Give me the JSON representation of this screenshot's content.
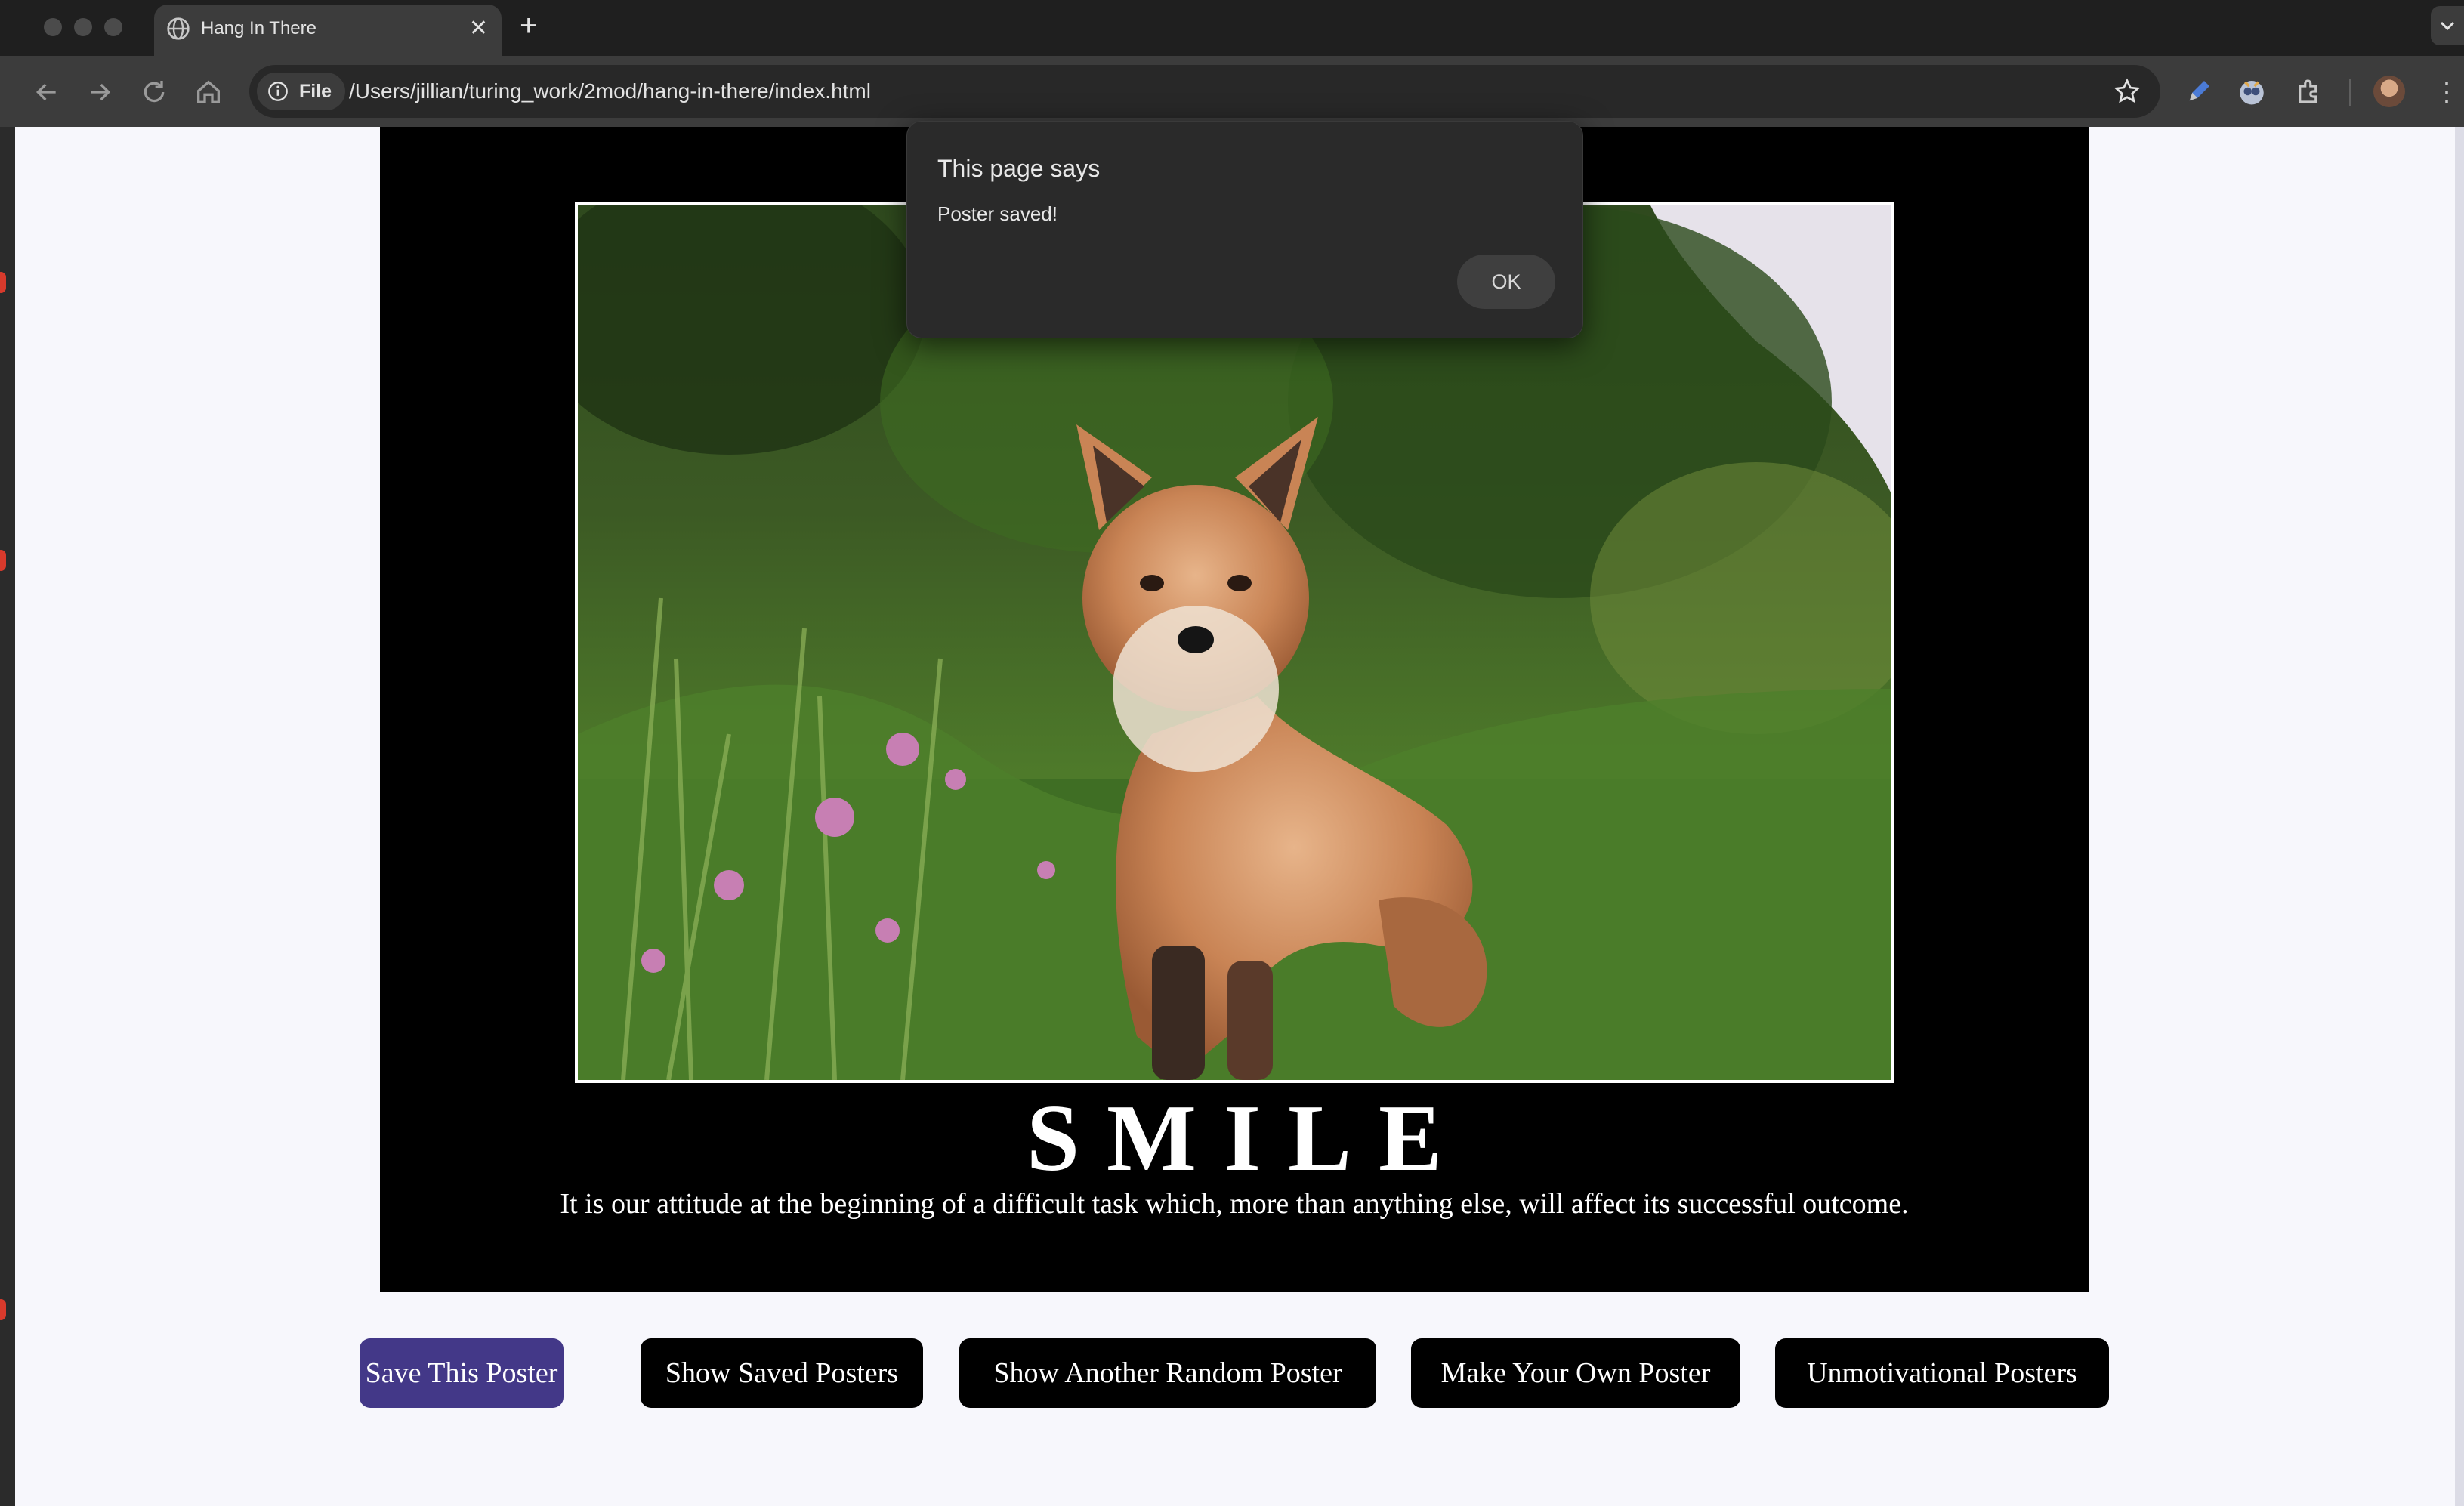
{
  "browser": {
    "tab_title": "Hang In There",
    "tab_close": "✕",
    "new_tab": "+",
    "site_chip_label": "File",
    "url": "/Users/jillian/turing_work/2mod/hang-in-there/index.html",
    "kebab": "⋮"
  },
  "poster": {
    "title": "SMILE",
    "quote": "It is our attitude at the beginning of a difficult task which, more than anything else, will affect its successful outcome."
  },
  "buttons": {
    "save": "Save This Poster",
    "show_saved": "Show Saved Posters",
    "random": "Show Another Random Poster",
    "make_own": "Make Your Own Poster",
    "unmotivational": "Unmotivational Posters"
  },
  "dialog": {
    "title": "This page says",
    "message": "Poster saved!",
    "ok_label": "OK"
  },
  "colors": {
    "primary_button": "#433888",
    "button": "#000000",
    "page_background": "#f7f7fc"
  }
}
